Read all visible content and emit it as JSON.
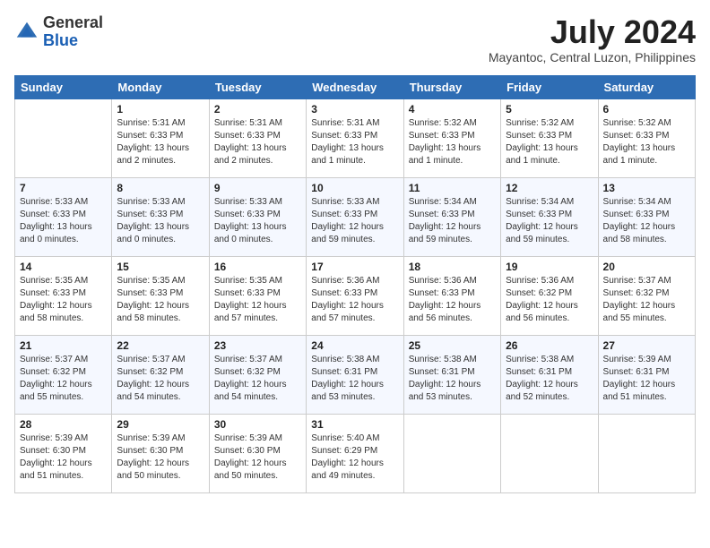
{
  "header": {
    "logo_general": "General",
    "logo_blue": "Blue",
    "month_title": "July 2024",
    "location": "Mayantoc, Central Luzon, Philippines"
  },
  "weekdays": [
    "Sunday",
    "Monday",
    "Tuesday",
    "Wednesday",
    "Thursday",
    "Friday",
    "Saturday"
  ],
  "weeks": [
    [
      {
        "day": "",
        "info": ""
      },
      {
        "day": "1",
        "info": "Sunrise: 5:31 AM\nSunset: 6:33 PM\nDaylight: 13 hours\nand 2 minutes."
      },
      {
        "day": "2",
        "info": "Sunrise: 5:31 AM\nSunset: 6:33 PM\nDaylight: 13 hours\nand 2 minutes."
      },
      {
        "day": "3",
        "info": "Sunrise: 5:31 AM\nSunset: 6:33 PM\nDaylight: 13 hours\nand 1 minute."
      },
      {
        "day": "4",
        "info": "Sunrise: 5:32 AM\nSunset: 6:33 PM\nDaylight: 13 hours\nand 1 minute."
      },
      {
        "day": "5",
        "info": "Sunrise: 5:32 AM\nSunset: 6:33 PM\nDaylight: 13 hours\nand 1 minute."
      },
      {
        "day": "6",
        "info": "Sunrise: 5:32 AM\nSunset: 6:33 PM\nDaylight: 13 hours\nand 1 minute."
      }
    ],
    [
      {
        "day": "7",
        "info": "Sunrise: 5:33 AM\nSunset: 6:33 PM\nDaylight: 13 hours\nand 0 minutes."
      },
      {
        "day": "8",
        "info": "Sunrise: 5:33 AM\nSunset: 6:33 PM\nDaylight: 13 hours\nand 0 minutes."
      },
      {
        "day": "9",
        "info": "Sunrise: 5:33 AM\nSunset: 6:33 PM\nDaylight: 13 hours\nand 0 minutes."
      },
      {
        "day": "10",
        "info": "Sunrise: 5:33 AM\nSunset: 6:33 PM\nDaylight: 12 hours\nand 59 minutes."
      },
      {
        "day": "11",
        "info": "Sunrise: 5:34 AM\nSunset: 6:33 PM\nDaylight: 12 hours\nand 59 minutes."
      },
      {
        "day": "12",
        "info": "Sunrise: 5:34 AM\nSunset: 6:33 PM\nDaylight: 12 hours\nand 59 minutes."
      },
      {
        "day": "13",
        "info": "Sunrise: 5:34 AM\nSunset: 6:33 PM\nDaylight: 12 hours\nand 58 minutes."
      }
    ],
    [
      {
        "day": "14",
        "info": "Sunrise: 5:35 AM\nSunset: 6:33 PM\nDaylight: 12 hours\nand 58 minutes."
      },
      {
        "day": "15",
        "info": "Sunrise: 5:35 AM\nSunset: 6:33 PM\nDaylight: 12 hours\nand 58 minutes."
      },
      {
        "day": "16",
        "info": "Sunrise: 5:35 AM\nSunset: 6:33 PM\nDaylight: 12 hours\nand 57 minutes."
      },
      {
        "day": "17",
        "info": "Sunrise: 5:36 AM\nSunset: 6:33 PM\nDaylight: 12 hours\nand 57 minutes."
      },
      {
        "day": "18",
        "info": "Sunrise: 5:36 AM\nSunset: 6:33 PM\nDaylight: 12 hours\nand 56 minutes."
      },
      {
        "day": "19",
        "info": "Sunrise: 5:36 AM\nSunset: 6:32 PM\nDaylight: 12 hours\nand 56 minutes."
      },
      {
        "day": "20",
        "info": "Sunrise: 5:37 AM\nSunset: 6:32 PM\nDaylight: 12 hours\nand 55 minutes."
      }
    ],
    [
      {
        "day": "21",
        "info": "Sunrise: 5:37 AM\nSunset: 6:32 PM\nDaylight: 12 hours\nand 55 minutes."
      },
      {
        "day": "22",
        "info": "Sunrise: 5:37 AM\nSunset: 6:32 PM\nDaylight: 12 hours\nand 54 minutes."
      },
      {
        "day": "23",
        "info": "Sunrise: 5:37 AM\nSunset: 6:32 PM\nDaylight: 12 hours\nand 54 minutes."
      },
      {
        "day": "24",
        "info": "Sunrise: 5:38 AM\nSunset: 6:31 PM\nDaylight: 12 hours\nand 53 minutes."
      },
      {
        "day": "25",
        "info": "Sunrise: 5:38 AM\nSunset: 6:31 PM\nDaylight: 12 hours\nand 53 minutes."
      },
      {
        "day": "26",
        "info": "Sunrise: 5:38 AM\nSunset: 6:31 PM\nDaylight: 12 hours\nand 52 minutes."
      },
      {
        "day": "27",
        "info": "Sunrise: 5:39 AM\nSunset: 6:31 PM\nDaylight: 12 hours\nand 51 minutes."
      }
    ],
    [
      {
        "day": "28",
        "info": "Sunrise: 5:39 AM\nSunset: 6:30 PM\nDaylight: 12 hours\nand 51 minutes."
      },
      {
        "day": "29",
        "info": "Sunrise: 5:39 AM\nSunset: 6:30 PM\nDaylight: 12 hours\nand 50 minutes."
      },
      {
        "day": "30",
        "info": "Sunrise: 5:39 AM\nSunset: 6:30 PM\nDaylight: 12 hours\nand 50 minutes."
      },
      {
        "day": "31",
        "info": "Sunrise: 5:40 AM\nSunset: 6:29 PM\nDaylight: 12 hours\nand 49 minutes."
      },
      {
        "day": "",
        "info": ""
      },
      {
        "day": "",
        "info": ""
      },
      {
        "day": "",
        "info": ""
      }
    ]
  ]
}
